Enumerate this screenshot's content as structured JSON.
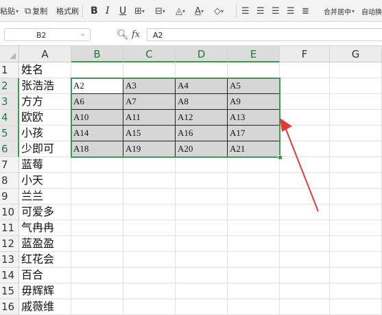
{
  "toolbar": {
    "paste": "粘贴",
    "copy": "复制",
    "format_painter": "格式刷",
    "bold": "B",
    "italic": "I",
    "underline": "U",
    "merge_center": "合并居中",
    "auto_wrap": "自动换"
  },
  "formula_bar": {
    "name_box": "B2",
    "fx_label": "fx",
    "formula": "A2"
  },
  "columns": [
    "A",
    "B",
    "C",
    "D",
    "E",
    "F",
    "G"
  ],
  "rows": [
    "1",
    "2",
    "3",
    "4",
    "5",
    "6",
    "7",
    "8",
    "9",
    "10",
    "11",
    "12",
    "13",
    "14",
    "15",
    "16"
  ],
  "names": {
    "header": "姓名",
    "list": [
      "张浩浩",
      "方方",
      "欧欧",
      "小孩",
      "少即可",
      "蓝莓",
      "小天",
      "兰兰",
      "可爱多",
      "气冉冉",
      "蓝盈盈",
      "红花会",
      "百合",
      "毋辉辉",
      "戚薇维"
    ]
  },
  "grid": [
    [
      "A2",
      "A3",
      "A4",
      "A5"
    ],
    [
      "A6",
      "A7",
      "A8",
      "A9"
    ],
    [
      "A10",
      "A11",
      "A12",
      "A13"
    ],
    [
      "A14",
      "A15",
      "A16",
      "A17"
    ],
    [
      "A18",
      "A19",
      "A20",
      "A21"
    ]
  ],
  "colors": {
    "selection": "#3a9b4f",
    "arrow": "#e53935",
    "cell_shade": "#d6d6d6"
  }
}
